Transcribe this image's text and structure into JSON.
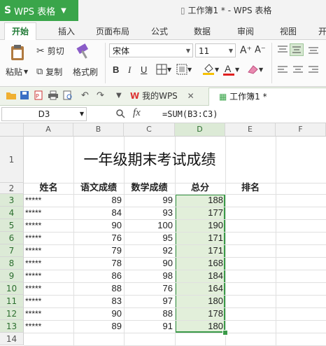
{
  "titlebar": {
    "app_name": "WPS 表格",
    "title": "工作簿1 * - WPS 表格"
  },
  "ribbon_tabs": [
    "开始",
    "插入",
    "页面布局",
    "公式",
    "数据",
    "审阅",
    "视图",
    "开"
  ],
  "ribbon": {
    "paste_label": "粘贴",
    "cut_label": "剪切",
    "copy_label": "复制",
    "format_painter_label": "格式刷",
    "font_name": "宋体",
    "font_size": "11",
    "bold": "B",
    "italic": "I",
    "underline": "U",
    "grow_font": "A⁺",
    "shrink_font": "A⁻"
  },
  "doc_tabs": {
    "wps_tab": "我的WPS",
    "book_tab": "工作簿1 *"
  },
  "formula_bar": {
    "name_box": "D3",
    "fx": "fx",
    "formula": "=SUM(B3:C3)"
  },
  "sheet": {
    "columns": [
      "A",
      "B",
      "C",
      "D",
      "E",
      "F"
    ],
    "rows": [
      "1",
      "2",
      "3",
      "4",
      "5",
      "6",
      "7",
      "8",
      "9",
      "10",
      "11",
      "12",
      "13",
      "14"
    ],
    "title": "一年级期末考试成绩",
    "headers": [
      "姓名",
      "语文成绩",
      "数学成绩",
      "总分",
      "排名"
    ],
    "data": [
      [
        "*****",
        "89",
        "99",
        "188"
      ],
      [
        "*****",
        "84",
        "93",
        "177"
      ],
      [
        "*****",
        "90",
        "100",
        "190"
      ],
      [
        "*****",
        "76",
        "95",
        "171"
      ],
      [
        "*****",
        "79",
        "92",
        "171"
      ],
      [
        "*****",
        "78",
        "90",
        "168"
      ],
      [
        "*****",
        "86",
        "98",
        "184"
      ],
      [
        "*****",
        "88",
        "76",
        "164"
      ],
      [
        "*****",
        "83",
        "97",
        "180"
      ],
      [
        "*****",
        "90",
        "88",
        "178"
      ],
      [
        "*****",
        "89",
        "91",
        "180"
      ]
    ]
  },
  "colors": {
    "accent": "#3aa54a",
    "selection": "#e2efda"
  }
}
